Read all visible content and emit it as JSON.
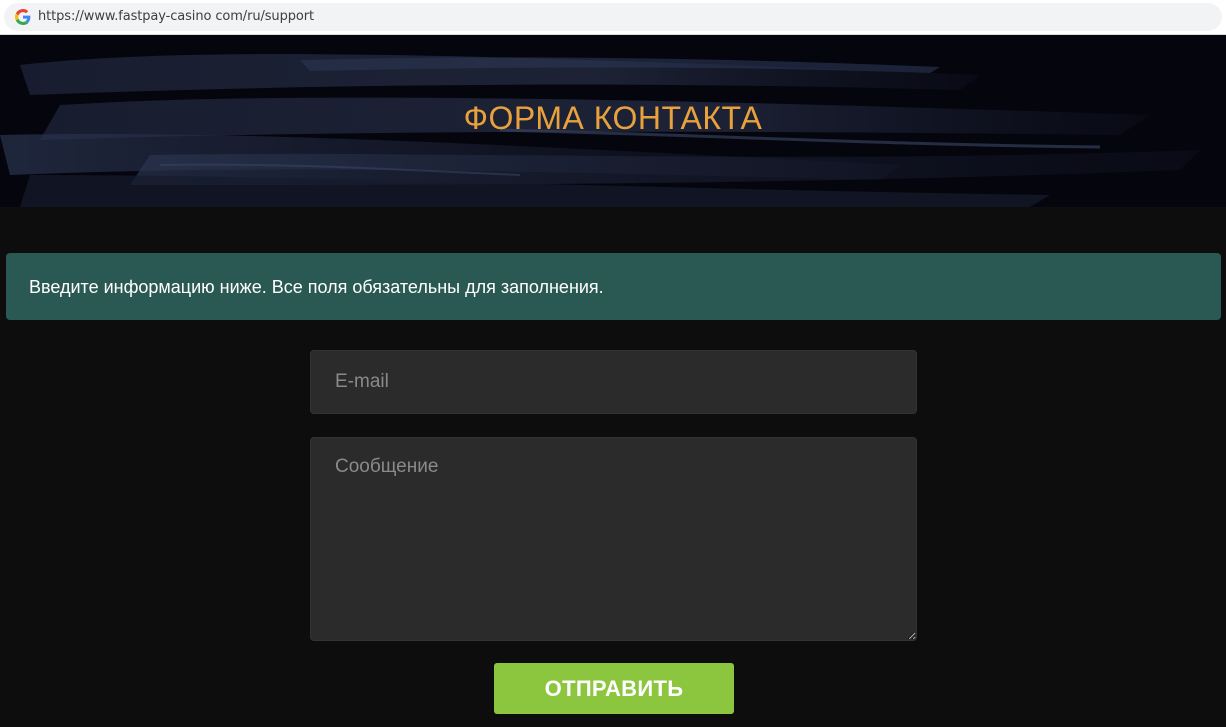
{
  "browser": {
    "url": "https://www.fastpay-casino com/ru/support",
    "favicon": "google-g-icon"
  },
  "hero": {
    "title": "ФОРМА КОНТАКТА"
  },
  "notice": {
    "text": "Введите информацию ниже. Все поля обязательны для заполнения."
  },
  "form": {
    "email": {
      "value": "",
      "placeholder": "E-mail"
    },
    "message": {
      "value": "",
      "placeholder": "Сообщение"
    },
    "submit_label": "ОТПРАВИТЬ"
  },
  "colors": {
    "title_accent": "#e8a13c",
    "notice_bg": "#2a5954",
    "button_bg": "#8cc63f",
    "page_bg": "#0d0d0d",
    "field_bg": "#2b2b2b"
  }
}
